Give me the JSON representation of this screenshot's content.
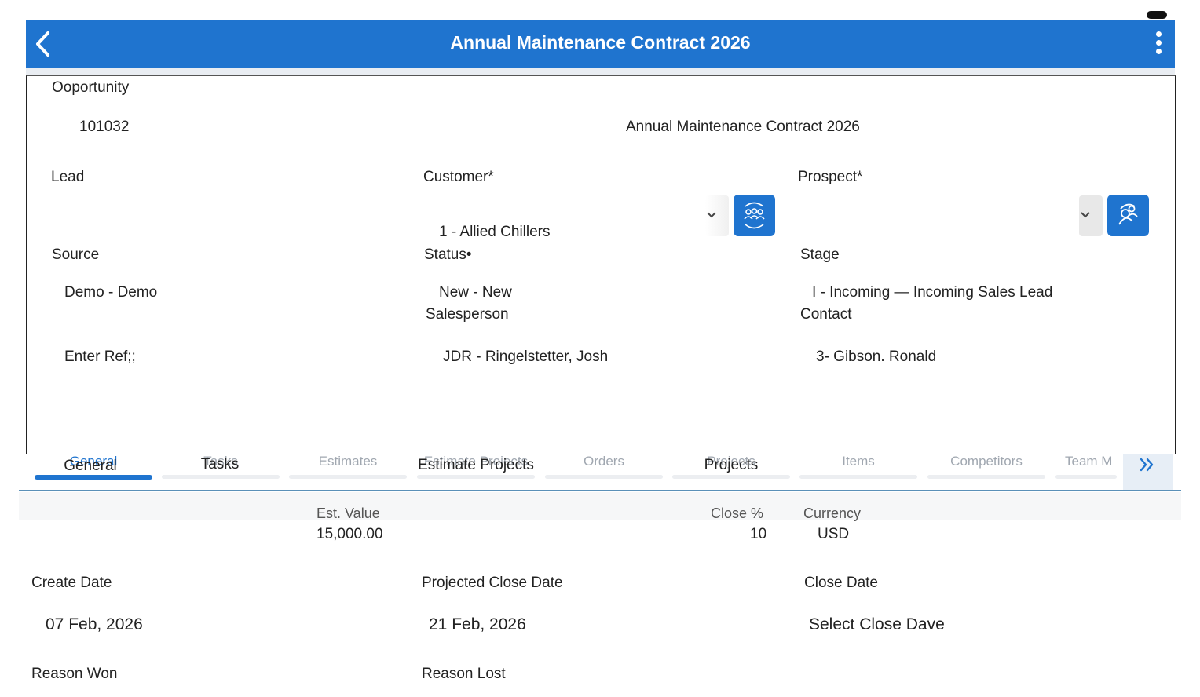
{
  "header": {
    "title": "Annual Maintenance Contract 2026"
  },
  "opportunity": {
    "label": "Ooportunity",
    "number": "101032",
    "name": "Annual Maintenance Contract 2026"
  },
  "fields": {
    "lead_label": "Lead",
    "customer_label": "Customer*",
    "customer_value": "1 - Allied Chillers",
    "prospect_label": "Prospect*",
    "source_label": "Source",
    "source_value": "Demo - Demo",
    "status_label": "Status•",
    "status_value": "New - New",
    "stage_label": "Stage",
    "stage_value": "I - Incoming — Incoming Sales Lead",
    "ref_placeholder": "Enter Ref;;",
    "salesperson_label": "Salesperson",
    "salesperson_value": "JDR - Ringelstetter, Josh",
    "contact_label": "Contact",
    "contact_value": "3- Gibson. Ronald"
  },
  "tabs": [
    {
      "label": "General",
      "underlying": "General",
      "active": true
    },
    {
      "label": "Tasks",
      "underlying": "Tasks",
      "active": false
    },
    {
      "label": "",
      "underlying": "Estimates",
      "active": false
    },
    {
      "label": "Estimate Projects",
      "underlying": "Estimate Projects",
      "active": false
    },
    {
      "label": "",
      "underlying": "Orders",
      "active": false
    },
    {
      "label": "Projects",
      "underlying": "Projects",
      "active": false
    },
    {
      "label": "",
      "underlying": "Items",
      "active": false
    },
    {
      "label": "",
      "underlying": "Competitors",
      "active": false
    },
    {
      "label": "",
      "underlying": "Team M",
      "active": false
    }
  ],
  "general": {
    "est_value_label": "Est. Value",
    "est_value": "15,000.00",
    "close_pct_label": "Close %",
    "close_pct": "10",
    "currency_label": "Currency",
    "currency": "USD",
    "create_date_label": "Create Date",
    "create_date": "07 Feb, 2026",
    "projected_close_label": "Projected Close Date",
    "projected_close": "21 Feb, 2026",
    "close_date_label": "Close Date",
    "close_date_placeholder": "Select Close Dave",
    "reason_won_label": "Reason Won",
    "reason_lost_label": "Reason Lost"
  },
  "colors": {
    "accent": "#1f74cf",
    "tab_line": "#5a90b8"
  },
  "icons": {
    "back": "chevron-left-icon",
    "menu": "kebab-menu-icon",
    "customer_button": "customer-group-icon",
    "prospect_button": "prospect-icon",
    "more_tabs": "double-chevron-right-icon"
  }
}
